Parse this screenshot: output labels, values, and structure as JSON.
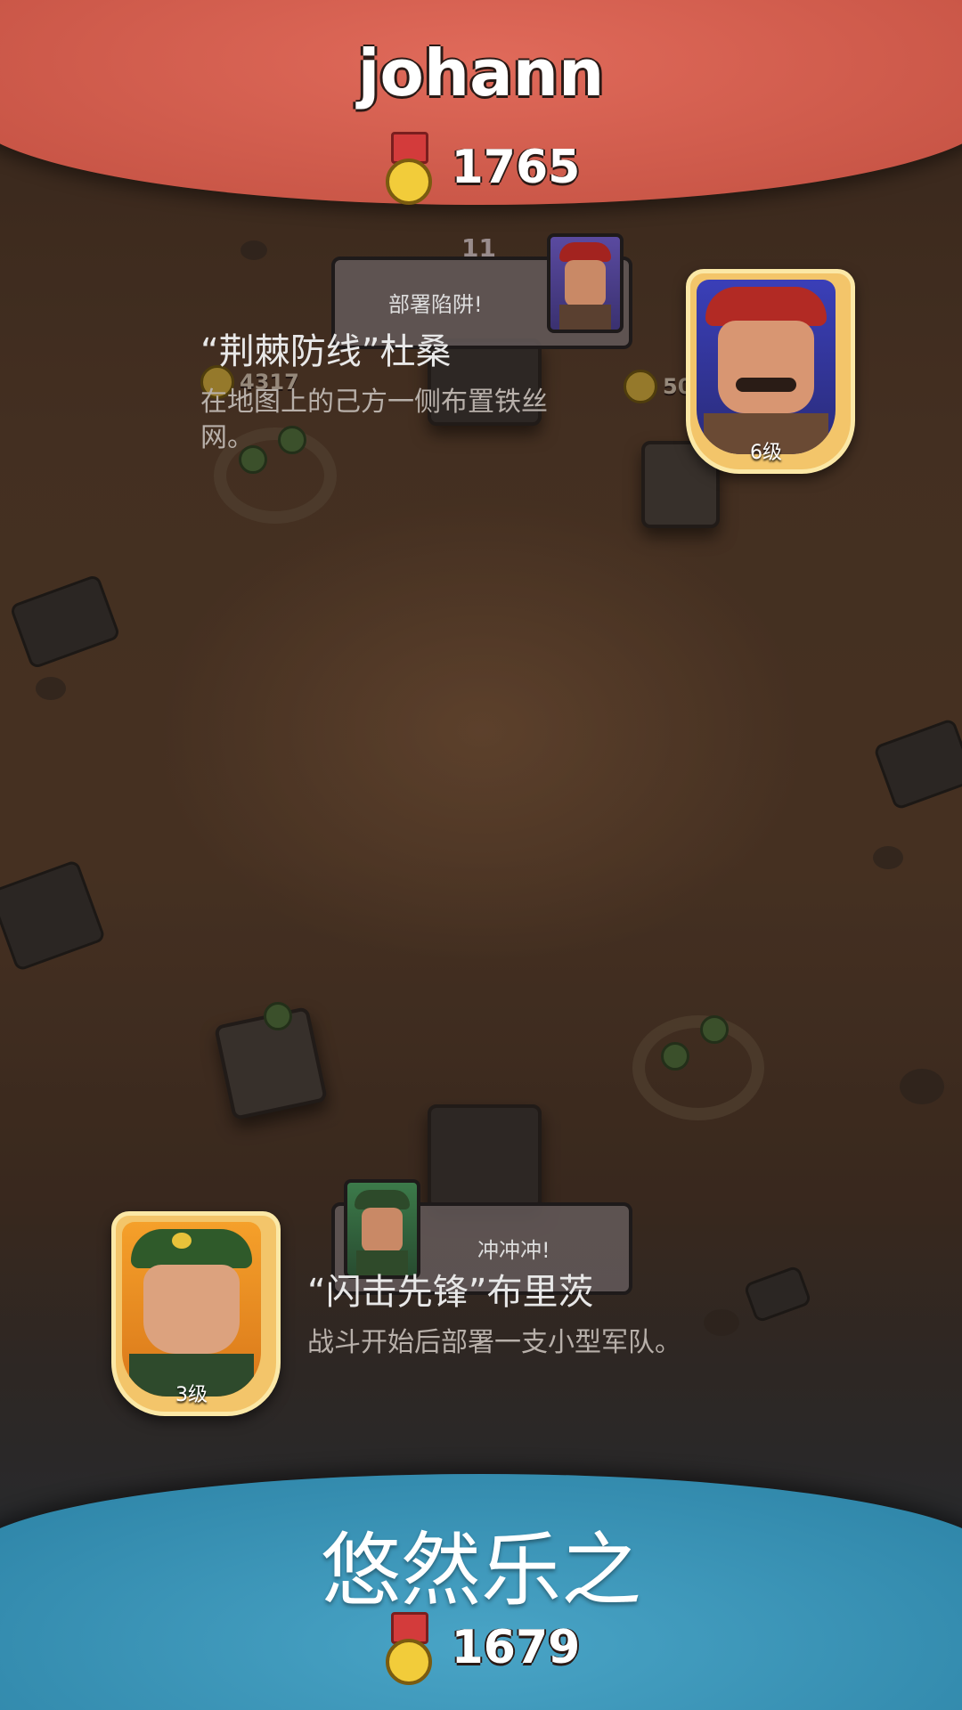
{
  "opponent": {
    "name": "johann",
    "trophies": "1765",
    "speech": "部署陷阱!",
    "commander": {
      "title": "“荆棘防线”杜桑",
      "description": "在地图上的己方一侧布置铁丝网。",
      "level": "6级"
    },
    "banner_color": "#d35f50"
  },
  "player": {
    "name": "悠然乐之",
    "trophies": "1679",
    "speech": "冲冲冲!",
    "commander": {
      "title": "“闪击先锋”布里茨",
      "description": "战斗开始后部署一支小型军队。",
      "level": "3级"
    },
    "banner_color": "#3a93b8"
  },
  "map_labels": {
    "left_building_hp": "4317",
    "right_building_hp": "50",
    "top_number": "11"
  },
  "icons": [
    "medal-icon",
    "trophy-icon"
  ]
}
